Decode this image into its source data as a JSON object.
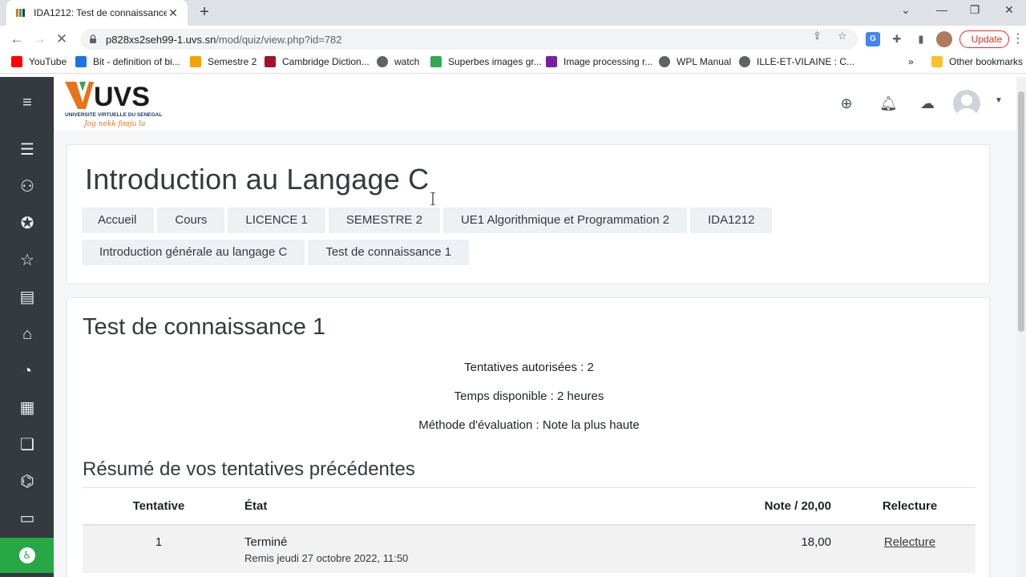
{
  "browser": {
    "tab_title": "IDA1212: Test de connaissance 1",
    "tab_close": "✕",
    "new_tab": "+",
    "url_host": "p828xs2seh99-1.uvs.sn",
    "url_path": "/mod/quiz/view.php?id=782",
    "update_label": "Update",
    "bookmarks": [
      {
        "label": "YouTube",
        "color": "#ff0000"
      },
      {
        "label": "Bit - definition of bi...",
        "color": "#1a73e8"
      },
      {
        "label": "Semestre 2",
        "color": "#f4a300"
      },
      {
        "label": "Cambridge Diction...",
        "color": "#a3122a"
      },
      {
        "label": "watch",
        "color": "#5f6368"
      },
      {
        "label": "Superbes images gr...",
        "color": "#34a853"
      },
      {
        "label": "Image processing r...",
        "color": "#7b1fa2"
      },
      {
        "label": "WPL Manual",
        "color": "#5f6368"
      },
      {
        "label": "ILLE-ET-VILAINE : C...",
        "color": "#5f6368"
      }
    ],
    "other_bookmarks": "Other bookmarks",
    "more": "»"
  },
  "site": {
    "logo_text": "UVS",
    "logo_subtitle": "UNIVERSITE VIRTUELLE DU SENEGAL",
    "logo_tagline": "Jog nekk fooju la"
  },
  "course": {
    "title": "Introduction au Langage C",
    "breadcrumbs": [
      "Accueil",
      "Cours",
      "LICENCE 1",
      "SEMESTRE 2",
      "UE1 Algorithmique et Programmation 2",
      "IDA1212",
      "Introduction générale au langage C",
      "Test de connaissance 1"
    ]
  },
  "quiz": {
    "title": "Test de connaissance 1",
    "info": [
      "Tentatives autorisées : 2",
      "Temps disponible : 2 heures",
      "Méthode d'évaluation : Note la plus haute"
    ],
    "summary_title": "Résumé de vos tentatives précédentes",
    "columns": [
      "Tentative",
      "État",
      "Note / 20,00",
      "Relecture"
    ],
    "rows": [
      {
        "attempt": "1",
        "state": "Terminé",
        "submitted": "Remis jeudi 27 octobre 2022, 11:50",
        "grade": "18,00",
        "review": "Relecture"
      }
    ]
  },
  "colors": {
    "sidebar": "#343a40",
    "accessibility": "#28a745",
    "update": "#d93025",
    "logo_orange": "#e8731a",
    "logo_blue": "#1a3a6b"
  }
}
